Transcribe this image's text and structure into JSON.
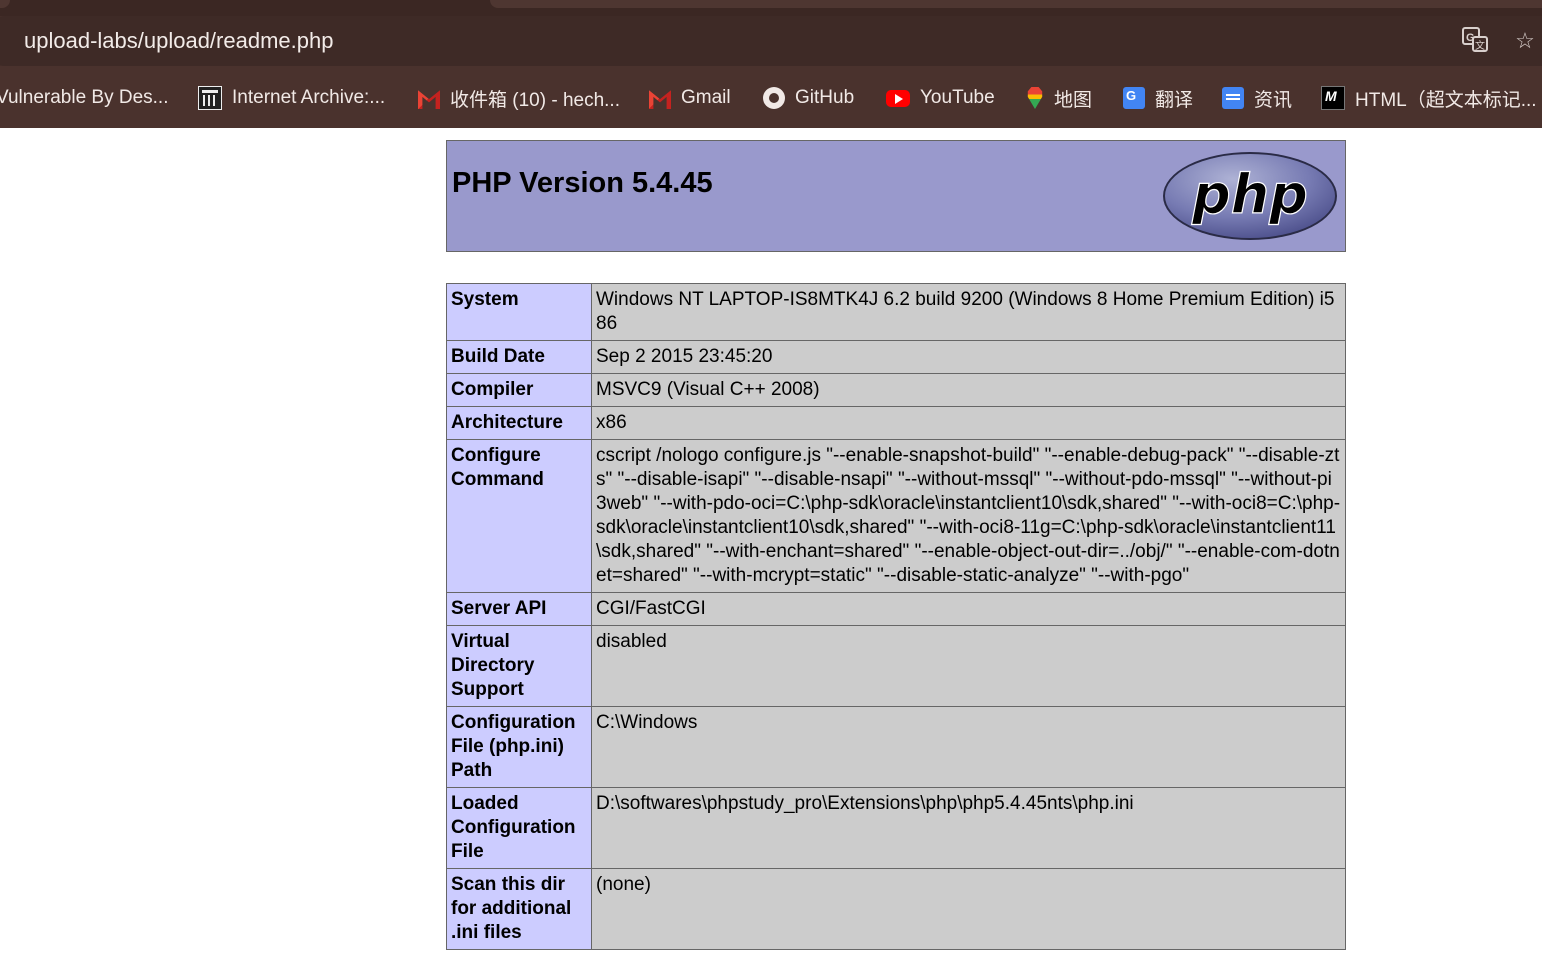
{
  "browser": {
    "url": "upload-labs/upload/readme.php",
    "icons": [
      "translate-icon",
      "bookmark-star-icon"
    ],
    "bookmarks": [
      {
        "label": "Vulnerable By Des...",
        "icon": "none"
      },
      {
        "label": "Internet Archive:...",
        "icon": "archive-icon"
      },
      {
        "label": "收件箱 (10) - hech...",
        "icon": "gmail-icon"
      },
      {
        "label": "Gmail",
        "icon": "gmail-icon"
      },
      {
        "label": "GitHub",
        "icon": "github-icon"
      },
      {
        "label": "YouTube",
        "icon": "youtube-icon"
      },
      {
        "label": "地图",
        "icon": "maps-icon"
      },
      {
        "label": "翻译",
        "icon": "translate-icon"
      },
      {
        "label": "资讯",
        "icon": "news-icon"
      },
      {
        "label": "HTML（超文本标记...",
        "icon": "mdn-icon"
      }
    ]
  },
  "php": {
    "title": "PHP Version 5.4.45",
    "logo_text": "php",
    "rows": [
      {
        "key": "System",
        "value": "Windows NT LAPTOP-IS8MTK4J 6.2 build 9200 (Windows 8 Home Premium Edition) i586"
      },
      {
        "key": "Build Date",
        "value": "Sep 2 2015 23:45:20"
      },
      {
        "key": "Compiler",
        "value": "MSVC9 (Visual C++ 2008)"
      },
      {
        "key": "Architecture",
        "value": "x86"
      },
      {
        "key": "Configure Command",
        "value": "cscript /nologo configure.js \"--enable-snapshot-build\" \"--enable-debug-pack\" \"--disable-zts\" \"--disable-isapi\" \"--disable-nsapi\" \"--without-mssql\" \"--without-pdo-mssql\" \"--without-pi3web\" \"--with-pdo-oci=C:\\php-sdk\\oracle\\instantclient10\\sdk,shared\" \"--with-oci8=C:\\php-sdk\\oracle\\instantclient10\\sdk,shared\" \"--with-oci8-11g=C:\\php-sdk\\oracle\\instantclient11\\sdk,shared\" \"--with-enchant=shared\" \"--enable-object-out-dir=../obj/\" \"--enable-com-dotnet=shared\" \"--with-mcrypt=static\" \"--disable-static-analyze\" \"--with-pgo\""
      },
      {
        "key": "Server API",
        "value": "CGI/FastCGI"
      },
      {
        "key": "Virtual Directory Support",
        "value": "disabled"
      },
      {
        "key": "Configuration File (php.ini) Path",
        "value": "C:\\Windows"
      },
      {
        "key": "Loaded Configuration File",
        "value": "D:\\softwares\\phpstudy_pro\\Extensions\\php\\php5.4.45nts\\php.ini"
      },
      {
        "key": "Scan this dir for additional .ini files",
        "value": "(none)"
      }
    ]
  }
}
